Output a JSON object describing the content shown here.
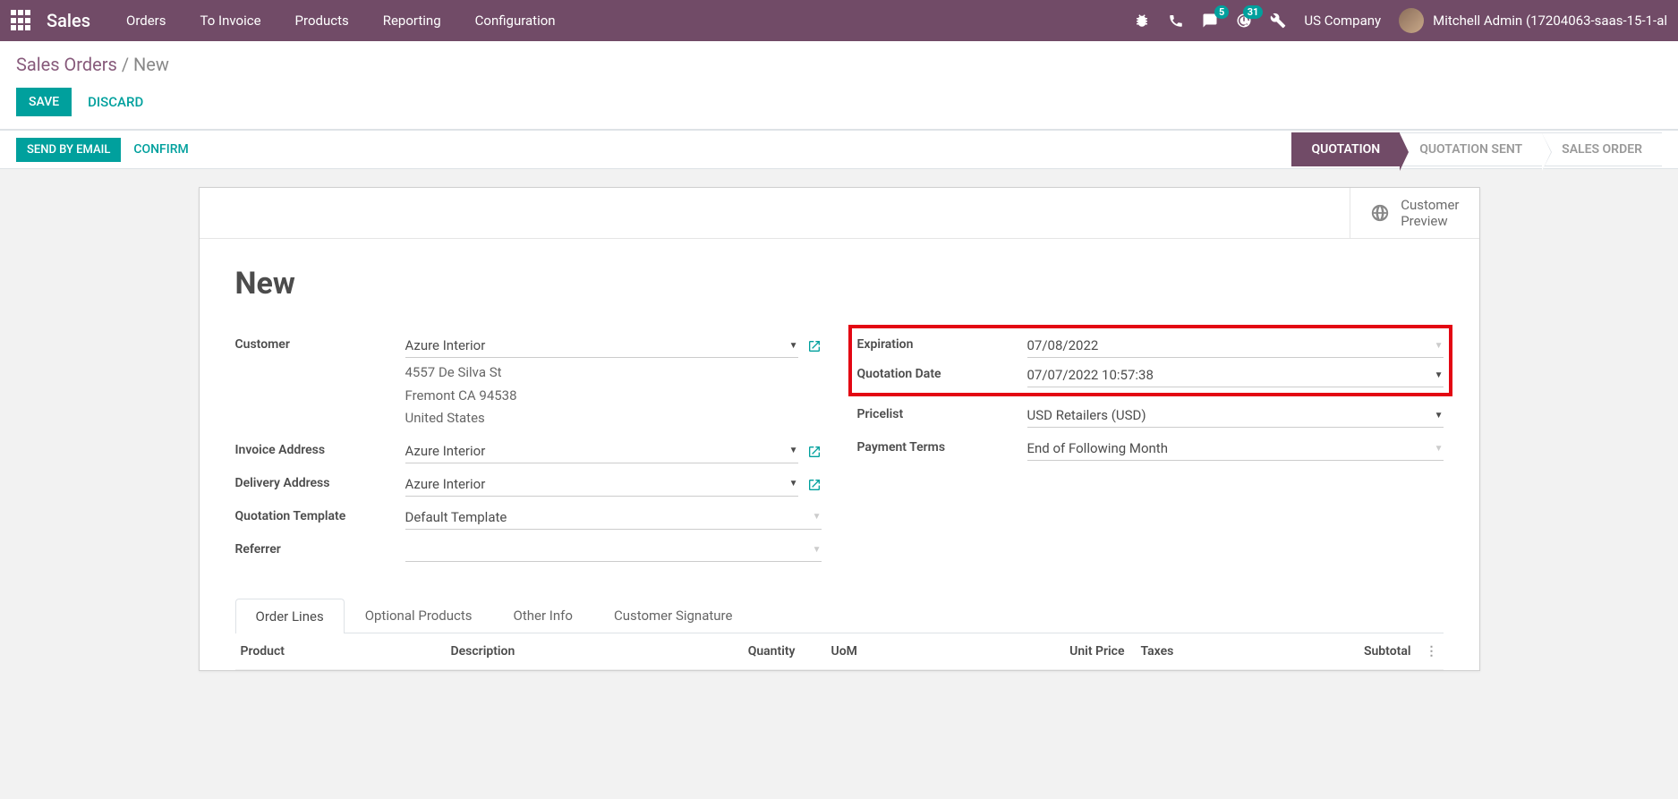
{
  "nav": {
    "brand": "Sales",
    "menu": [
      "Orders",
      "To Invoice",
      "Products",
      "Reporting",
      "Configuration"
    ],
    "msg_badge": "5",
    "activity_badge": "31",
    "company": "US Company",
    "user": "Mitchell Admin (17204063-saas-15-1-al"
  },
  "breadcrumb": {
    "root": "Sales Orders",
    "current": "New"
  },
  "buttons": {
    "save": "SAVE",
    "discard": "DISCARD",
    "send_email": "SEND BY EMAIL",
    "confirm": "CONFIRM"
  },
  "status": [
    "QUOTATION",
    "QUOTATION SENT",
    "SALES ORDER"
  ],
  "preview": {
    "line1": "Customer",
    "line2": "Preview"
  },
  "record_title": "New",
  "left": {
    "customer_label": "Customer",
    "customer_value": "Azure Interior",
    "addr1": "4557 De Silva St",
    "addr2": "Fremont CA 94538",
    "addr3": "United States",
    "invoice_label": "Invoice Address",
    "invoice_value": "Azure Interior",
    "delivery_label": "Delivery Address",
    "delivery_value": "Azure Interior",
    "template_label": "Quotation Template",
    "template_value": "Default Template",
    "referrer_label": "Referrer",
    "referrer_value": ""
  },
  "right": {
    "expiration_label": "Expiration",
    "expiration_value": "07/08/2022",
    "qdate_label": "Quotation Date",
    "qdate_value": "07/07/2022 10:57:38",
    "pricelist_label": "Pricelist",
    "pricelist_value": "USD Retailers (USD)",
    "terms_label": "Payment Terms",
    "terms_value": "End of Following Month"
  },
  "tabs": [
    "Order Lines",
    "Optional Products",
    "Other Info",
    "Customer Signature"
  ],
  "cols": {
    "product": "Product",
    "desc": "Description",
    "qty": "Quantity",
    "uom": "UoM",
    "price": "Unit Price",
    "taxes": "Taxes",
    "subtotal": "Subtotal"
  }
}
